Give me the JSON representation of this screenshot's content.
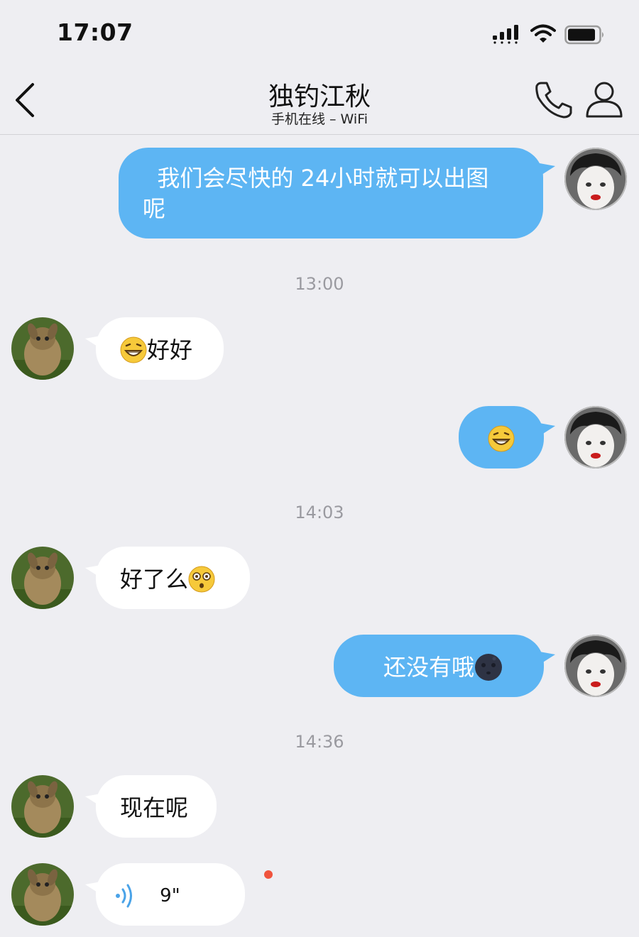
{
  "status_bar": {
    "time": "17:07",
    "icons": [
      "signal-icon",
      "wifi-icon",
      "battery-icon"
    ]
  },
  "nav": {
    "title": "独钓江秋",
    "subtitle": "手机在线 – WiFi",
    "icons": [
      "back-icon",
      "phone-icon",
      "profile-icon"
    ]
  },
  "colors": {
    "background": "#eeeef2",
    "self_bubble": "#5db5f3",
    "other_bubble": "#ffffff",
    "timestamp": "#9a9aa0",
    "unread_dot": "#f0533d"
  },
  "messages": {
    "m1": {
      "sender": "self",
      "line1": "  我们会尽快的 24小时就可以出图",
      "line2": "呢"
    },
    "t1": "13:00",
    "m2": {
      "sender": "other",
      "emoji": "grinning-face-icon",
      "text": "好好"
    },
    "m3": {
      "sender": "self",
      "emoji": "grinning-face-icon"
    },
    "t2": "14:03",
    "m4": {
      "sender": "other",
      "text": "好了么",
      "emoji": "dizzy-face-icon"
    },
    "m5": {
      "sender": "self",
      "text": "还没有哦",
      "emoji": "new-moon-face-icon"
    },
    "t3": "14:36",
    "m6": {
      "sender": "other",
      "text": "现在呢"
    },
    "m7": {
      "sender": "other",
      "type": "voice",
      "duration": "9\"",
      "icon": "voice-wave-icon",
      "unread": true
    }
  }
}
